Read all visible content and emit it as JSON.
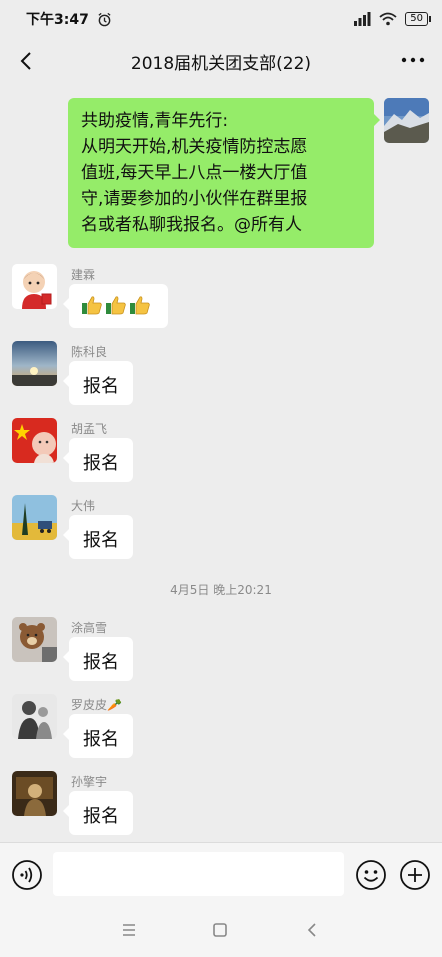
{
  "status_bar": {
    "time": "下午3:47",
    "battery": "50"
  },
  "header": {
    "title": "2018届机关团支部(22)",
    "back_icon": "chevron-left-icon",
    "more_icon": "more-dots-icon"
  },
  "messages": [
    {
      "type": "outgoing",
      "text": "共助疫情,青年先行:\n从明天开始,机关疫情防控志愿值班,每天早上八点一楼大厅值守,请要参加的小伙伴在群里报名或者私聊我报名。@所有人",
      "lines": [
        "共助疫情,青年先行:",
        "从明天开始,机关疫情防控志愿",
        "值班,每天早上八点一楼大厅值",
        "守,请要参加的小伙伴在群里报",
        "名或者私聊我报名。@所有人"
      ]
    },
    {
      "type": "incoming",
      "sender": "建霖",
      "content": "thumbs-up x3",
      "icon": "thumbs-up-icon"
    },
    {
      "type": "incoming",
      "sender": "陈科良",
      "text": "报名"
    },
    {
      "type": "incoming",
      "sender": "胡孟飞",
      "text": "报名"
    },
    {
      "type": "incoming",
      "sender": "大伟",
      "text": "报名"
    },
    {
      "type": "timestamp",
      "text": "4月5日 晚上20:21"
    },
    {
      "type": "incoming",
      "sender": "涂高雪",
      "text": "报名"
    },
    {
      "type": "incoming",
      "sender": "罗皮皮🥕",
      "text": "报名"
    },
    {
      "type": "incoming",
      "sender": "孙擎宇",
      "text": "报名"
    }
  ],
  "input_bar": {
    "voice_icon": "voice-icon",
    "emoji_icon": "emoji-icon",
    "plus_icon": "plus-icon",
    "value": ""
  },
  "nav_bar": {
    "menu_icon": "menu-icon",
    "home_icon": "home-square-icon",
    "back_icon": "back-triangle-icon"
  },
  "colors": {
    "background": "#ededed",
    "outgoing_bubble": "#95ec69",
    "incoming_bubble": "#ffffff",
    "meta_text": "#8a8a8a"
  }
}
